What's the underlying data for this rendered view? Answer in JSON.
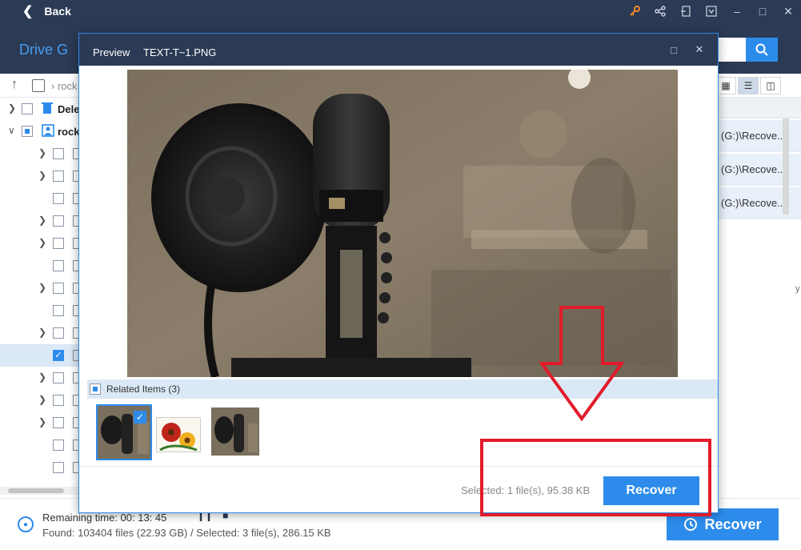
{
  "titlebar": {
    "back_label": "Back",
    "icons": [
      "key-icon",
      "share-icon",
      "login-icon",
      "menu-icon",
      "minimize-icon",
      "maximize-icon",
      "close-icon"
    ]
  },
  "header": {
    "drive_title": "Drive G"
  },
  "pathbar": {
    "path_text": "rock"
  },
  "tree": {
    "rows": [
      {
        "label": "Dele",
        "type": "deleted-folder"
      },
      {
        "label": "rock",
        "type": "user-folder"
      }
    ]
  },
  "table": {
    "rows": [
      "(G:)\\Recove...",
      "(G:)\\Recove...",
      "(G:)\\Recove..."
    ],
    "side_note": "y"
  },
  "footer": {
    "remaining_label": "Remaining time: 00: 13: 45",
    "found_label": "Found: 103404 files (22.93 GB) / Selected: 3 file(s), 286.15 KB",
    "recover_label": "Recover"
  },
  "dialog": {
    "title": "Preview",
    "filename": "TEXT-T~1.PNG",
    "related_label": "Related Items (3)",
    "selected_info": "Selected: 1 file(s), 95.38 KB",
    "recover_label": "Recover"
  },
  "colors": {
    "header_bg": "#2b3a55",
    "accent_blue": "#2d8ceb",
    "annotation_red": "#e21b2a",
    "selection_bg": "#dbe8f6"
  }
}
